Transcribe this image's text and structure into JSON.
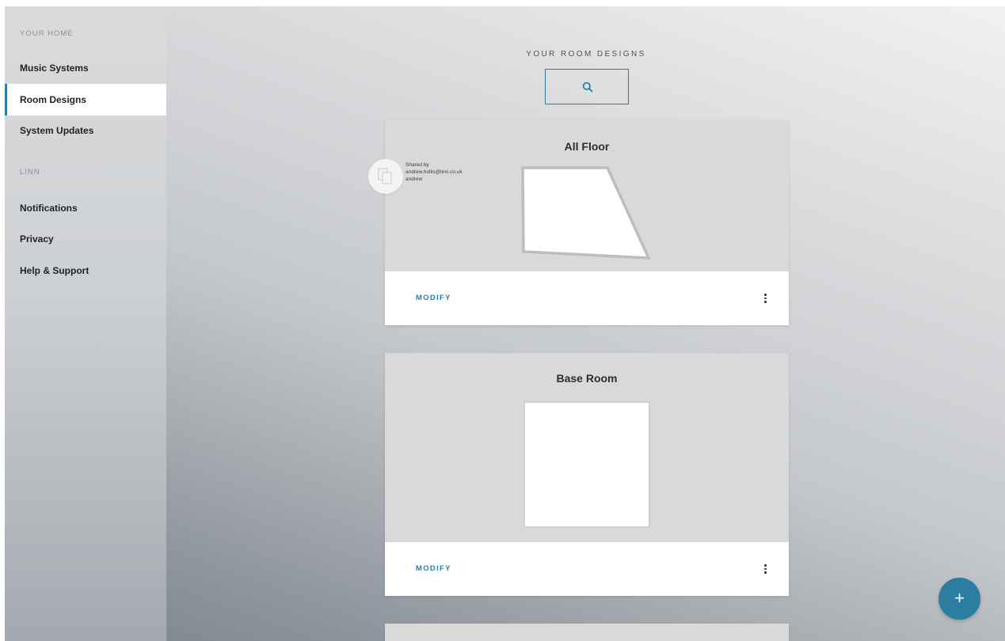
{
  "sidebar": {
    "home_section": "YOUR HOME",
    "home_items": [
      {
        "label": "Music Systems"
      },
      {
        "label": "Room Designs"
      },
      {
        "label": "System Updates"
      }
    ],
    "linn_section": "LINN",
    "linn_items": [
      {
        "label": "Notifications"
      },
      {
        "label": "Privacy"
      },
      {
        "label": "Help & Support"
      }
    ],
    "active_item": "Room Designs"
  },
  "main": {
    "title": "YOUR ROOM DESIGNS",
    "search_icon": "search-icon",
    "cards": [
      {
        "title": "All Floor",
        "modify_label": "MODIFY",
        "shared": {
          "label": "Shared by",
          "email": "andrew.hollis@linn.co.uk",
          "name": "andrew"
        }
      },
      {
        "title": "Base Room",
        "modify_label": "MODIFY"
      }
    ]
  },
  "fab": {
    "label": "+"
  },
  "colors": {
    "accent": "#2b7ea0",
    "card_bg": "#d9d9d9",
    "footer_bg": "#ffffff"
  }
}
